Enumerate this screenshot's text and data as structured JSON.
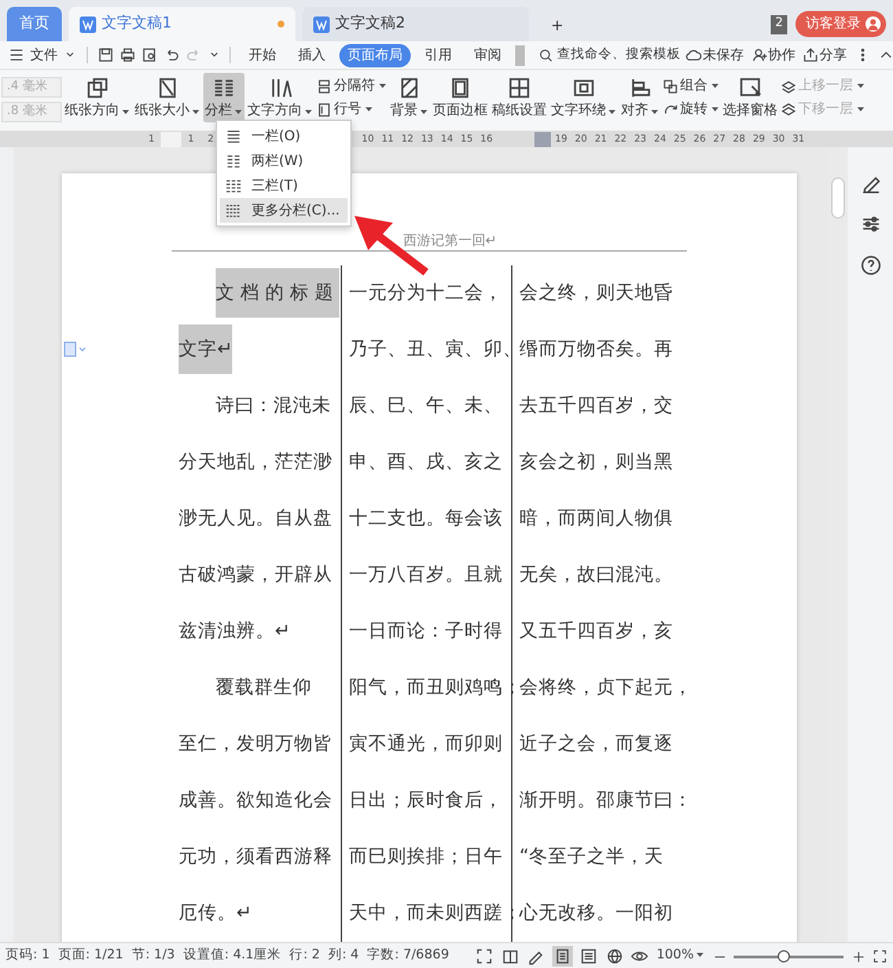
{
  "tabs": [
    {
      "label": "首页",
      "kind": "home",
      "selected": false,
      "unsaved": false
    },
    {
      "label": "文字文稿1",
      "kind": "doc",
      "selected": true,
      "unsaved": true
    },
    {
      "label": "文字文稿2",
      "kind": "doc",
      "selected": false,
      "unsaved": false
    }
  ],
  "new_tab": "+",
  "window_count": "2",
  "login_button": "访客登录",
  "menu": {
    "file": "文件",
    "ribbon_tabs": [
      {
        "label": "开始",
        "selected": false
      },
      {
        "label": "插入",
        "selected": false
      },
      {
        "label": "页面布局",
        "selected": true
      },
      {
        "label": "引用",
        "selected": false
      },
      {
        "label": "审阅",
        "selected": false
      }
    ],
    "search_placeholder": "查找命令、搜索模板",
    "actions": [
      "未保存",
      "协作",
      "分享"
    ]
  },
  "ribbon": {
    "margin_fields": [
      ".4 毫米",
      ".8 毫米"
    ],
    "items": [
      {
        "kind": "big",
        "label": "纸张方向",
        "dropdown": true,
        "pressed": false
      },
      {
        "kind": "big",
        "label": "纸张大小",
        "dropdown": true,
        "pressed": false
      },
      {
        "kind": "big",
        "label": "分栏",
        "dropdown": true,
        "pressed": true
      },
      {
        "kind": "big",
        "label": "文字方向",
        "dropdown": true,
        "pressed": false
      },
      {
        "kind": "stack",
        "items": [
          {
            "label": "分隔符",
            "disabled": false
          },
          {
            "label": "行号",
            "disabled": false
          }
        ]
      },
      {
        "kind": "big",
        "label": "背景",
        "dropdown": true,
        "pressed": false
      },
      {
        "kind": "big",
        "label": "页面边框",
        "dropdown": false,
        "pressed": false
      },
      {
        "kind": "big",
        "label": "稿纸设置",
        "dropdown": false,
        "pressed": false
      },
      {
        "kind": "big",
        "label": "文字环绕",
        "dropdown": true,
        "pressed": false
      },
      {
        "kind": "big",
        "label": "对齐",
        "dropdown": true,
        "pressed": false
      },
      {
        "kind": "stack",
        "items": [
          {
            "label": "组合",
            "disabled": false
          },
          {
            "label": "旋转",
            "disabled": false
          }
        ]
      },
      {
        "kind": "big",
        "label": "选择窗格",
        "dropdown": false,
        "pressed": false
      },
      {
        "kind": "stack",
        "items": [
          {
            "label": "上移一层",
            "disabled": true
          },
          {
            "label": "下移一层",
            "disabled": true
          }
        ]
      }
    ]
  },
  "ruler": {
    "left_marks": [
      "1",
      "1",
      "2"
    ],
    "right_marks": [
      "10",
      "11",
      "12",
      "13",
      "14",
      "15",
      "16"
    ],
    "far_marks": [
      "19",
      "20",
      "21",
      "22",
      "23",
      "24",
      "25",
      "26",
      "27",
      "28",
      "29",
      "30",
      "31"
    ]
  },
  "columns_menu": {
    "items": [
      {
        "label": "一栏(O)",
        "selected": false
      },
      {
        "label": "两栏(W)",
        "selected": false
      },
      {
        "label": "三栏(T)",
        "selected": false
      },
      {
        "label": "更多分栏(C)...",
        "selected": true
      }
    ]
  },
  "document": {
    "header": "西游记第一回↵",
    "columns": [
      {
        "lines": [
          {
            "text": "文档的标题",
            "kind": "indent",
            "selected": true
          },
          {
            "text": "文字↵",
            "kind": "line",
            "selected": true
          },
          {
            "text": "诗曰：混沌未",
            "kind": "indent",
            "selected": false
          },
          {
            "text": "分天地乱，茫茫渺",
            "kind": "line",
            "selected": false
          },
          {
            "text": "渺无人见。自从盘",
            "kind": "line",
            "selected": false
          },
          {
            "text": "古破鸿蒙，开辟从",
            "kind": "line",
            "selected": false
          },
          {
            "text": "兹清浊辨。↵",
            "kind": "line",
            "selected": false
          },
          {
            "text": "覆载群生仰",
            "kind": "indent",
            "selected": false
          },
          {
            "text": "至仁，发明万物皆",
            "kind": "line",
            "selected": false
          },
          {
            "text": "成善。欲知造化会",
            "kind": "line",
            "selected": false
          },
          {
            "text": "元功，须看西游释",
            "kind": "line",
            "selected": false
          },
          {
            "text": "厄传。↵",
            "kind": "line",
            "selected": false
          }
        ]
      },
      {
        "lines": [
          {
            "text": "一元分为十二会，",
            "kind": "line",
            "selected": false
          },
          {
            "text": "乃子、丑、寅、卯、",
            "kind": "line",
            "selected": false
          },
          {
            "text": "辰、巳、午、未、",
            "kind": "line",
            "selected": false
          },
          {
            "text": "申、酉、戌、亥之",
            "kind": "line",
            "selected": false
          },
          {
            "text": "十二支也。每会该",
            "kind": "line",
            "selected": false
          },
          {
            "text": "一万八百岁。且就",
            "kind": "line",
            "selected": false
          },
          {
            "text": "一日而论：子时得",
            "kind": "line",
            "selected": false
          },
          {
            "text": "阳气，而丑则鸡鸣；",
            "kind": "line",
            "selected": false
          },
          {
            "text": "寅不通光，而卯则",
            "kind": "line",
            "selected": false
          },
          {
            "text": "日出；辰时食后，",
            "kind": "line",
            "selected": false
          },
          {
            "text": "而巳则挨排；日午",
            "kind": "line",
            "selected": false
          },
          {
            "text": "天中，而未则西蹉；",
            "kind": "line",
            "selected": false
          }
        ]
      },
      {
        "lines": [
          {
            "text": "会之终，则天地昏",
            "kind": "line",
            "selected": false
          },
          {
            "text": "缗而万物否矣。再",
            "kind": "line",
            "selected": false
          },
          {
            "text": "去五千四百岁，交",
            "kind": "line",
            "selected": false
          },
          {
            "text": "亥会之初，则当黑",
            "kind": "line",
            "selected": false
          },
          {
            "text": "暗，而两间人物俱",
            "kind": "line",
            "selected": false
          },
          {
            "text": "无矣，故曰混沌。",
            "kind": "line",
            "selected": false
          },
          {
            "text": "又五千四百岁，亥",
            "kind": "line",
            "selected": false
          },
          {
            "text": "会将终，贞下起元，",
            "kind": "line",
            "selected": false
          },
          {
            "text": "近子之会，而复逐",
            "kind": "line",
            "selected": false
          },
          {
            "text": "渐开明。邵康节曰：",
            "kind": "line",
            "selected": false
          },
          {
            "text": "“冬至子之半，天",
            "kind": "line",
            "selected": false
          },
          {
            "text": "心无改移。一阳初",
            "kind": "line",
            "selected": false
          }
        ]
      }
    ]
  },
  "status_bar": {
    "items": [
      "页码: 1",
      "页面: 1/21",
      "节: 1/3",
      "设置值: 4.1厘米",
      "行: 2",
      "列: 4",
      "字数: 7/6869"
    ],
    "zoom": "100%",
    "zoom_slider": {
      "level": 0.45
    }
  }
}
